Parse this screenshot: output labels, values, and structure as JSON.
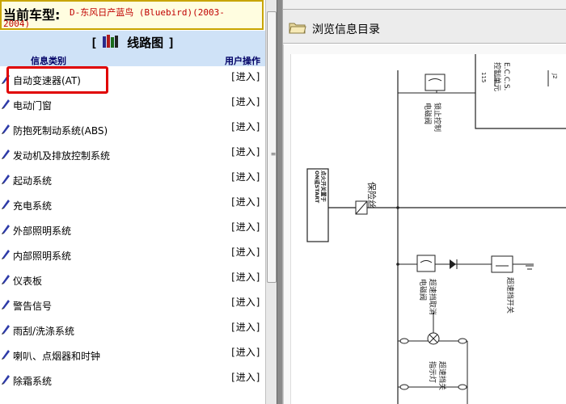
{
  "car": {
    "label": "当前车型:",
    "value_line1": "D-东风日产蓝鸟 (Bluebird)(2003-",
    "value_line2": "2004)"
  },
  "section": {
    "title": "线路图",
    "bracket_open": "[",
    "bracket_close": "]"
  },
  "columns": {
    "type": "信息类别",
    "action": "用户操作"
  },
  "items": [
    {
      "label": "自动变速器(AT)",
      "action": "[进入]"
    },
    {
      "label": "电动门窗",
      "action": "[进入]"
    },
    {
      "label": "防抱死制动系统(ABS)",
      "action": "[进入]"
    },
    {
      "label": "发动机及排放控制系统",
      "action": "[进入]"
    },
    {
      "label": "起动系统",
      "action": "[进入]"
    },
    {
      "label": "充电系统",
      "action": "[进入]"
    },
    {
      "label": "外部照明系统",
      "action": "[进入]"
    },
    {
      "label": "内部照明系统",
      "action": "[进入]"
    },
    {
      "label": "仪表板",
      "action": "[进入]"
    },
    {
      "label": "警告信号",
      "action": "[进入]"
    },
    {
      "label": "雨刮/洗涤系统",
      "action": "[进入]"
    },
    {
      "label": "喇叭、点烟器和时钟",
      "action": "[进入]"
    },
    {
      "label": "除霜系统",
      "action": "[进入]"
    }
  ],
  "browse": {
    "title": "浏览信息目录"
  },
  "diagram": {
    "ecu_label_line1": "E.C.C.S.",
    "ecu_label_line2": "控制单元",
    "pin_115": "115",
    "pin_j2": "J2",
    "lockup_valve_line1": "锁止控制",
    "lockup_valve_line2": "电磁阀",
    "ignition_switch_line1": "点火开关置于",
    "ignition_switch_line2": "ON或START",
    "fuse": "保险丝",
    "od_cancel_line1": "超速挡取消",
    "od_cancel_line2": "电磁阀",
    "od_switch": "超速挡开关",
    "od_lamp_line1": "超速挡关",
    "od_lamp_line2": "指示灯"
  },
  "colors": {
    "header_bg": "#fffde0",
    "car_value": "#c00000",
    "section_bg": "#cfe2f7",
    "highlight": "#e00000",
    "bullet": "#2d3aa8"
  },
  "icons": {
    "bullet": "blue-pen-icon",
    "section": "books-icon",
    "browse": "folder-icon"
  }
}
